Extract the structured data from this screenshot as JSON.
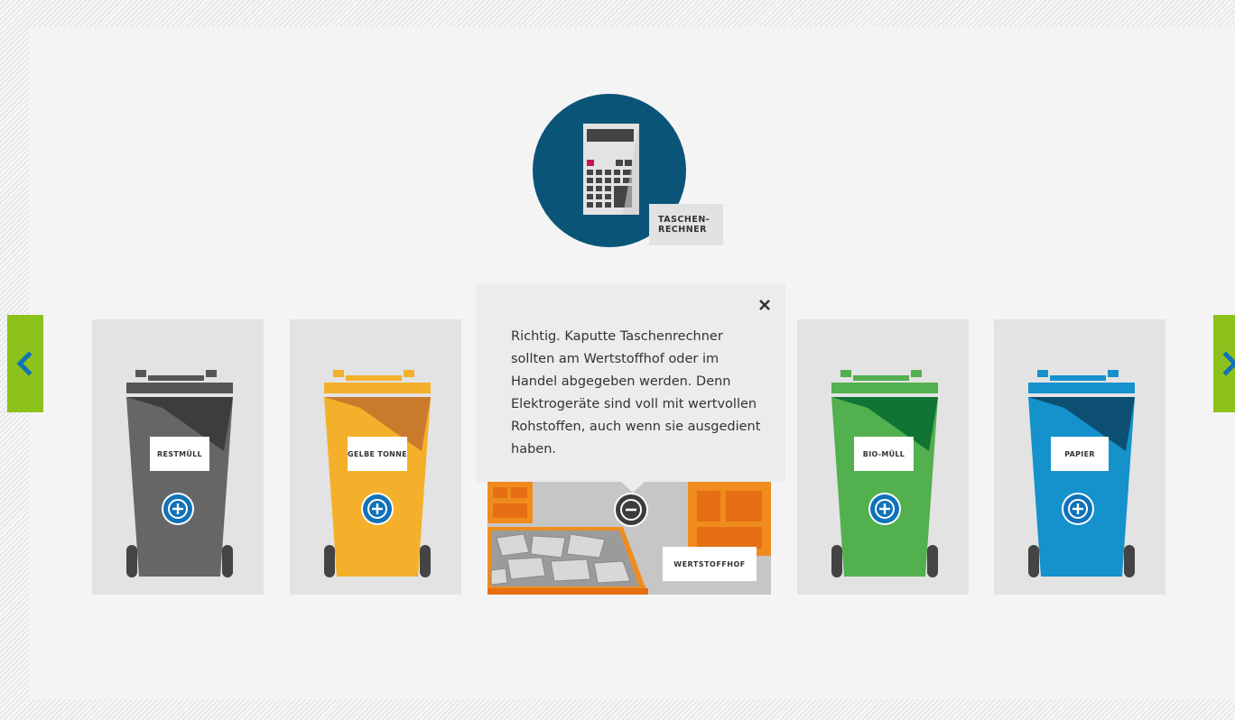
{
  "item": {
    "label": "TASCHEN-\nRECHNER",
    "icon": "calculator-icon",
    "circle_color": "#0a5577"
  },
  "navigation": {
    "prev_icon": "chevron-left-icon",
    "next_icon": "chevron-right-icon",
    "color": "#8dc11c"
  },
  "bins": [
    {
      "label": "RESTMÜLL",
      "color": "#666666",
      "action_icon": "plus-circle-icon"
    },
    {
      "label": "GELBE TONNE",
      "color": "#f4b02a",
      "action_icon": "plus-circle-icon"
    },
    {
      "label": "WERTSTOFFHOF",
      "color": "#f08c1e",
      "action_icon": "minus-circle-icon"
    },
    {
      "label": "BIO-MÜLL",
      "color": "#52b04e",
      "action_icon": "plus-circle-icon"
    },
    {
      "label": "PAPIER",
      "color": "#1591cc",
      "action_icon": "plus-circle-icon"
    }
  ],
  "popup": {
    "text": "Richtig. Kaputte Taschenrechner sollten am Wertstoffhof oder im Handel abgegeben werden. Denn Elektrogeräte sind voll mit wertvollen Rohstoffen, auch wenn sie ausgedient haben.",
    "close_icon": "close-icon"
  },
  "colors": {
    "accent_blue": "#1072b8",
    "button_dark": "#3c3c3c"
  }
}
